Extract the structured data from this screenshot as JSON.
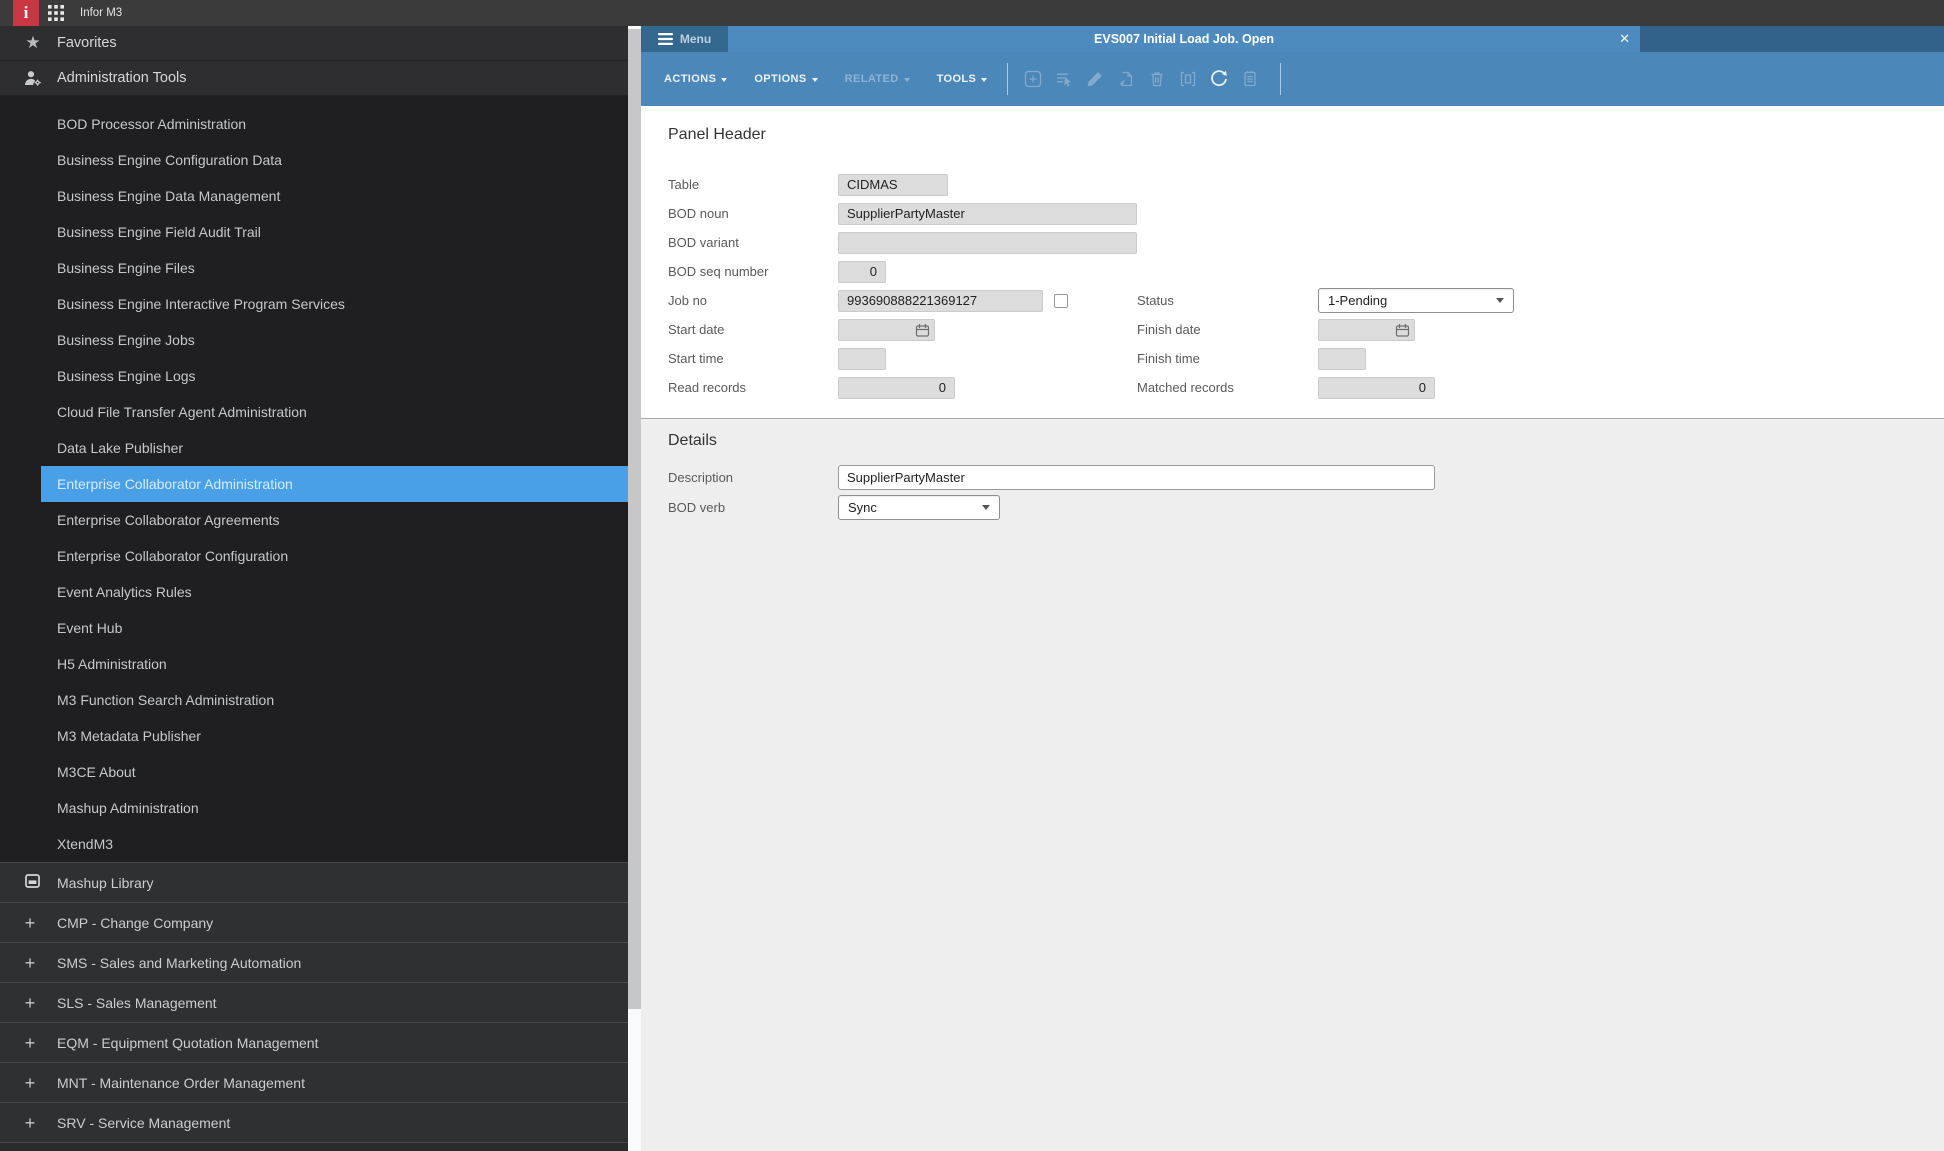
{
  "topbar": {
    "app_title": "Infor M3"
  },
  "sidebar": {
    "favorites_label": "Favorites",
    "admin_tools_label": "Administration Tools",
    "items": [
      {
        "label": "BOD Processor Administration",
        "selected": false
      },
      {
        "label": "Business Engine Configuration Data",
        "selected": false
      },
      {
        "label": "Business Engine Data Management",
        "selected": false
      },
      {
        "label": "Business Engine Field Audit Trail",
        "selected": false
      },
      {
        "label": "Business Engine Files",
        "selected": false
      },
      {
        "label": "Business Engine Interactive Program Services",
        "selected": false
      },
      {
        "label": "Business Engine Jobs",
        "selected": false
      },
      {
        "label": "Business Engine Logs",
        "selected": false
      },
      {
        "label": "Cloud File Transfer Agent Administration",
        "selected": false
      },
      {
        "label": "Data Lake Publisher",
        "selected": false
      },
      {
        "label": "Enterprise Collaborator Administration",
        "selected": true
      },
      {
        "label": "Enterprise Collaborator Agreements",
        "selected": false
      },
      {
        "label": "Enterprise Collaborator Configuration",
        "selected": false
      },
      {
        "label": "Event Analytics Rules",
        "selected": false
      },
      {
        "label": "Event Hub",
        "selected": false
      },
      {
        "label": "H5 Administration",
        "selected": false
      },
      {
        "label": "M3 Function Search Administration",
        "selected": false
      },
      {
        "label": "M3 Metadata Publisher",
        "selected": false
      },
      {
        "label": "M3CE About",
        "selected": false
      },
      {
        "label": "Mashup Administration",
        "selected": false
      },
      {
        "label": "XtendM3",
        "selected": false
      }
    ],
    "sections": [
      {
        "label": "Mashup Library",
        "icon": "window-icon"
      },
      {
        "label": "CMP - Change Company",
        "icon": "plus-icon"
      },
      {
        "label": "SMS - Sales and Marketing Automation",
        "icon": "plus-icon"
      },
      {
        "label": "SLS - Sales Management",
        "icon": "plus-icon"
      },
      {
        "label": "EQM - Equipment Quotation Management",
        "icon": "plus-icon"
      },
      {
        "label": "MNT - Maintenance Order Management",
        "icon": "plus-icon"
      },
      {
        "label": "SRV - Service Management",
        "icon": "plus-icon"
      }
    ]
  },
  "window": {
    "menu_label": "Menu",
    "title": "EVS007 Initial Load Job. Open",
    "close_glyph": "✕"
  },
  "toolbar": {
    "menus": [
      {
        "label": "ACTIONS",
        "enabled": true
      },
      {
        "label": "OPTIONS",
        "enabled": true
      },
      {
        "label": "RELATED",
        "enabled": false
      },
      {
        "label": "TOOLS",
        "enabled": true
      }
    ],
    "icon_names": [
      "create-icon",
      "select-rows-icon",
      "edit-icon",
      "copy-icon",
      "delete-icon",
      "display-icon",
      "refresh-icon",
      "notes-icon"
    ]
  },
  "panel_header": {
    "title": "Panel Header",
    "fields": {
      "table": {
        "label": "Table",
        "value": "CIDMAS"
      },
      "bod_noun": {
        "label": "BOD noun",
        "value": "SupplierPartyMaster"
      },
      "bod_variant": {
        "label": "BOD variant",
        "value": ""
      },
      "bod_seq_number": {
        "label": "BOD seq number",
        "value": "0"
      },
      "job_no": {
        "label": "Job no",
        "value": "993690888221369127"
      },
      "status": {
        "label": "Status",
        "value": "1-Pending"
      },
      "start_date": {
        "label": "Start date",
        "value": ""
      },
      "finish_date": {
        "label": "Finish date",
        "value": ""
      },
      "start_time": {
        "label": "Start time",
        "value": ""
      },
      "finish_time": {
        "label": "Finish time",
        "value": ""
      },
      "read_records": {
        "label": "Read records",
        "value": "0"
      },
      "matched_records": {
        "label": "Matched records",
        "value": "0"
      }
    }
  },
  "details": {
    "title": "Details",
    "fields": {
      "description": {
        "label": "Description",
        "value": "SupplierPartyMaster"
      },
      "bod_verb": {
        "label": "BOD verb",
        "value": "Sync"
      }
    }
  },
  "colors": {
    "infor_red": "#c93742",
    "topbar_bg": "#3b3b3c",
    "sidebar_bg": "#1f1f21",
    "selected_blue": "#49a0e6",
    "tab_blue": "#4d8bbe",
    "toolbar_blue": "#4b87b8",
    "tabbar_dark_blue": "#32618a",
    "details_bg": "#eeeeee",
    "disabled_input_bg": "#dcdcdc"
  }
}
